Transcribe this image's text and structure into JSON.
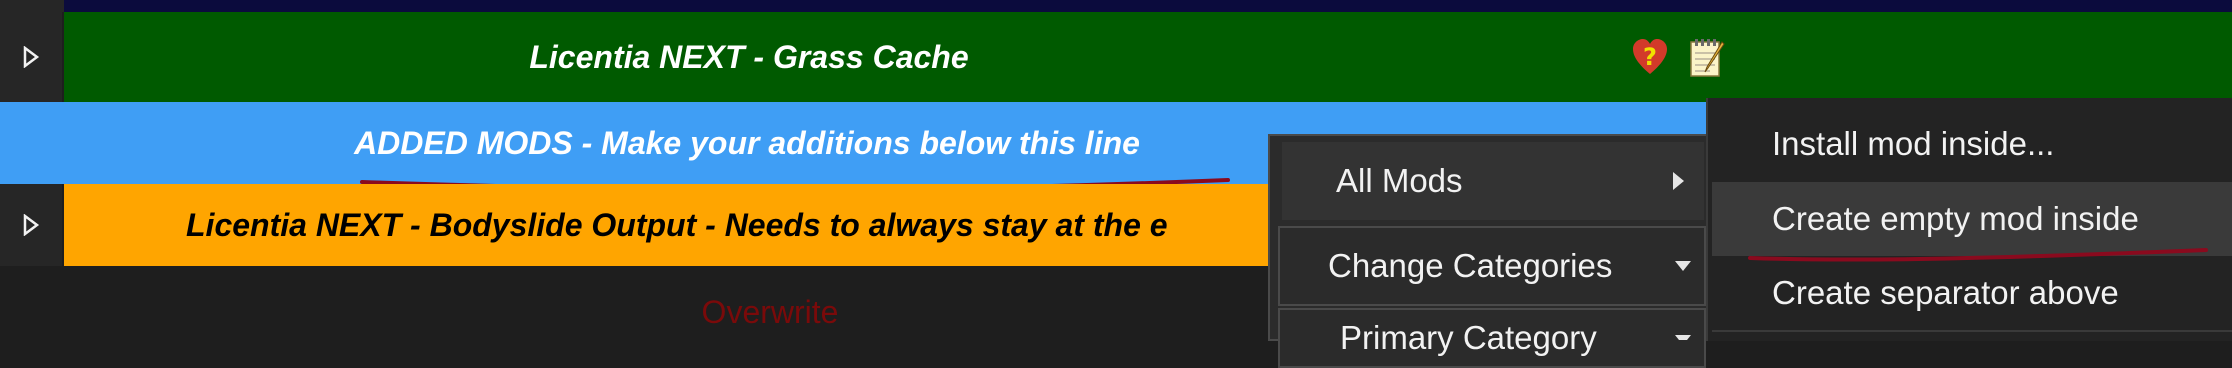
{
  "mod_list": {
    "rows": [
      {
        "name": "Licentia NEXT - Grass Cache",
        "expand_icon": "expand-triangle-icon",
        "color": "#005a00",
        "text_color": "#ffffff"
      },
      {
        "name": "ADDED MODS - Make your additions below this line",
        "color": "#3f9ef5",
        "text_color": "#ffffff"
      },
      {
        "name": "Licentia NEXT - Bodyslide Output - Needs to always stay at the e",
        "expand_icon": "expand-triangle-icon",
        "color": "#ffa500",
        "text_color": "#000000"
      },
      {
        "name": "Overwrite",
        "color": "#1e1e1e",
        "text_color": "#7a0a0a"
      }
    ],
    "row_icons": [
      "heart-question-icon",
      "notepad-icon"
    ]
  },
  "context_menu": {
    "items": [
      {
        "label": "All Mods",
        "has_submenu": true
      },
      {
        "label": "Change Categories",
        "has_dropdown": true
      },
      {
        "label": "Primary Category",
        "has_dropdown": true
      }
    ]
  },
  "submenu": {
    "items": [
      {
        "label": "Install mod inside..."
      },
      {
        "label": "Create empty mod inside",
        "highlighted": true
      },
      {
        "label": "Create separator above"
      }
    ]
  },
  "annotation_color": "#8a0a1e"
}
